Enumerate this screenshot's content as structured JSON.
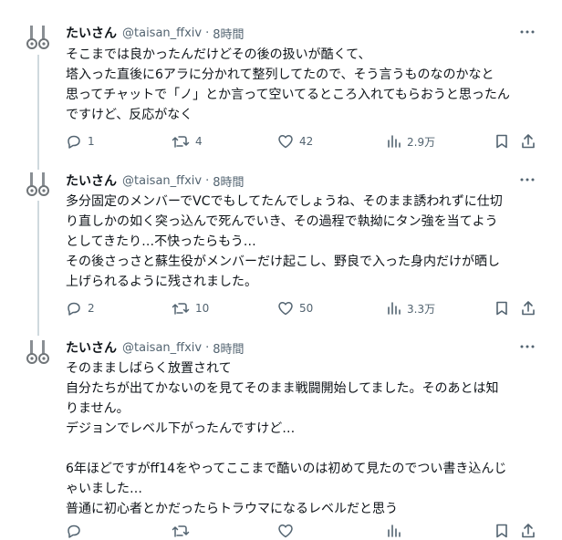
{
  "tweets": [
    {
      "name": "たいさん",
      "handle": "@taisan_ffxiv",
      "sep": "·",
      "time": "8時間",
      "lines": [
        "そこまでは良かったんだけどその後の扱いが酷くて、",
        "塔入った直後に6アラに分かれて整列してたので、そう言うものなのかなと",
        "思ってチャットで「ノ」とか言って空いてるところ入れてもらおうと思ったん",
        "ですけど、反応がなく"
      ],
      "replies": "1",
      "retweets": "4",
      "likes": "42",
      "views": "2.9万"
    },
    {
      "name": "たいさん",
      "handle": "@taisan_ffxiv",
      "sep": "·",
      "time": "8時間",
      "lines": [
        "多分固定のメンバーでVCでもしてたんでしょうね、そのまま誘われずに仕切",
        "り直しかの如く突っ込んで死んでいき、その過程で執拗にタン強を当てよう",
        "としてきたり…不快ったらもう…",
        "その後さっさと蘇生役がメンバーだけ起こし、野良で入った身内だけが晒し",
        "上げられるように残されました。"
      ],
      "replies": "2",
      "retweets": "10",
      "likes": "50",
      "views": "3.3万"
    },
    {
      "name": "たいさん",
      "handle": "@taisan_ffxiv",
      "sep": "·",
      "time": "8時間",
      "lines": [
        "そのまましばらく放置されて",
        "自分たちが出てかないのを見てそのまま戦闘開始してました。そのあとは知",
        "りません。",
        "デジョンでレベル下がったんですけど…",
        "",
        "6年ほどですがff14をやってここまで酷いのは初めて見たのでつい書き込んじ",
        "ゃいました…",
        "普通に初心者とかだったらトラウマになるレベルだと思う"
      ]
    }
  ],
  "icons": {
    "more": "more-dots-icon",
    "reply": "reply-bubble-icon",
    "retweet": "retweet-icon",
    "like": "heart-icon",
    "views": "views-bar-icon",
    "bookmark": "bookmark-icon",
    "share": "share-icon"
  },
  "colors": {
    "text": "#0f1419",
    "secondary": "#536471",
    "thread_line": "#cfd9de",
    "divider": "#eff3f4"
  }
}
